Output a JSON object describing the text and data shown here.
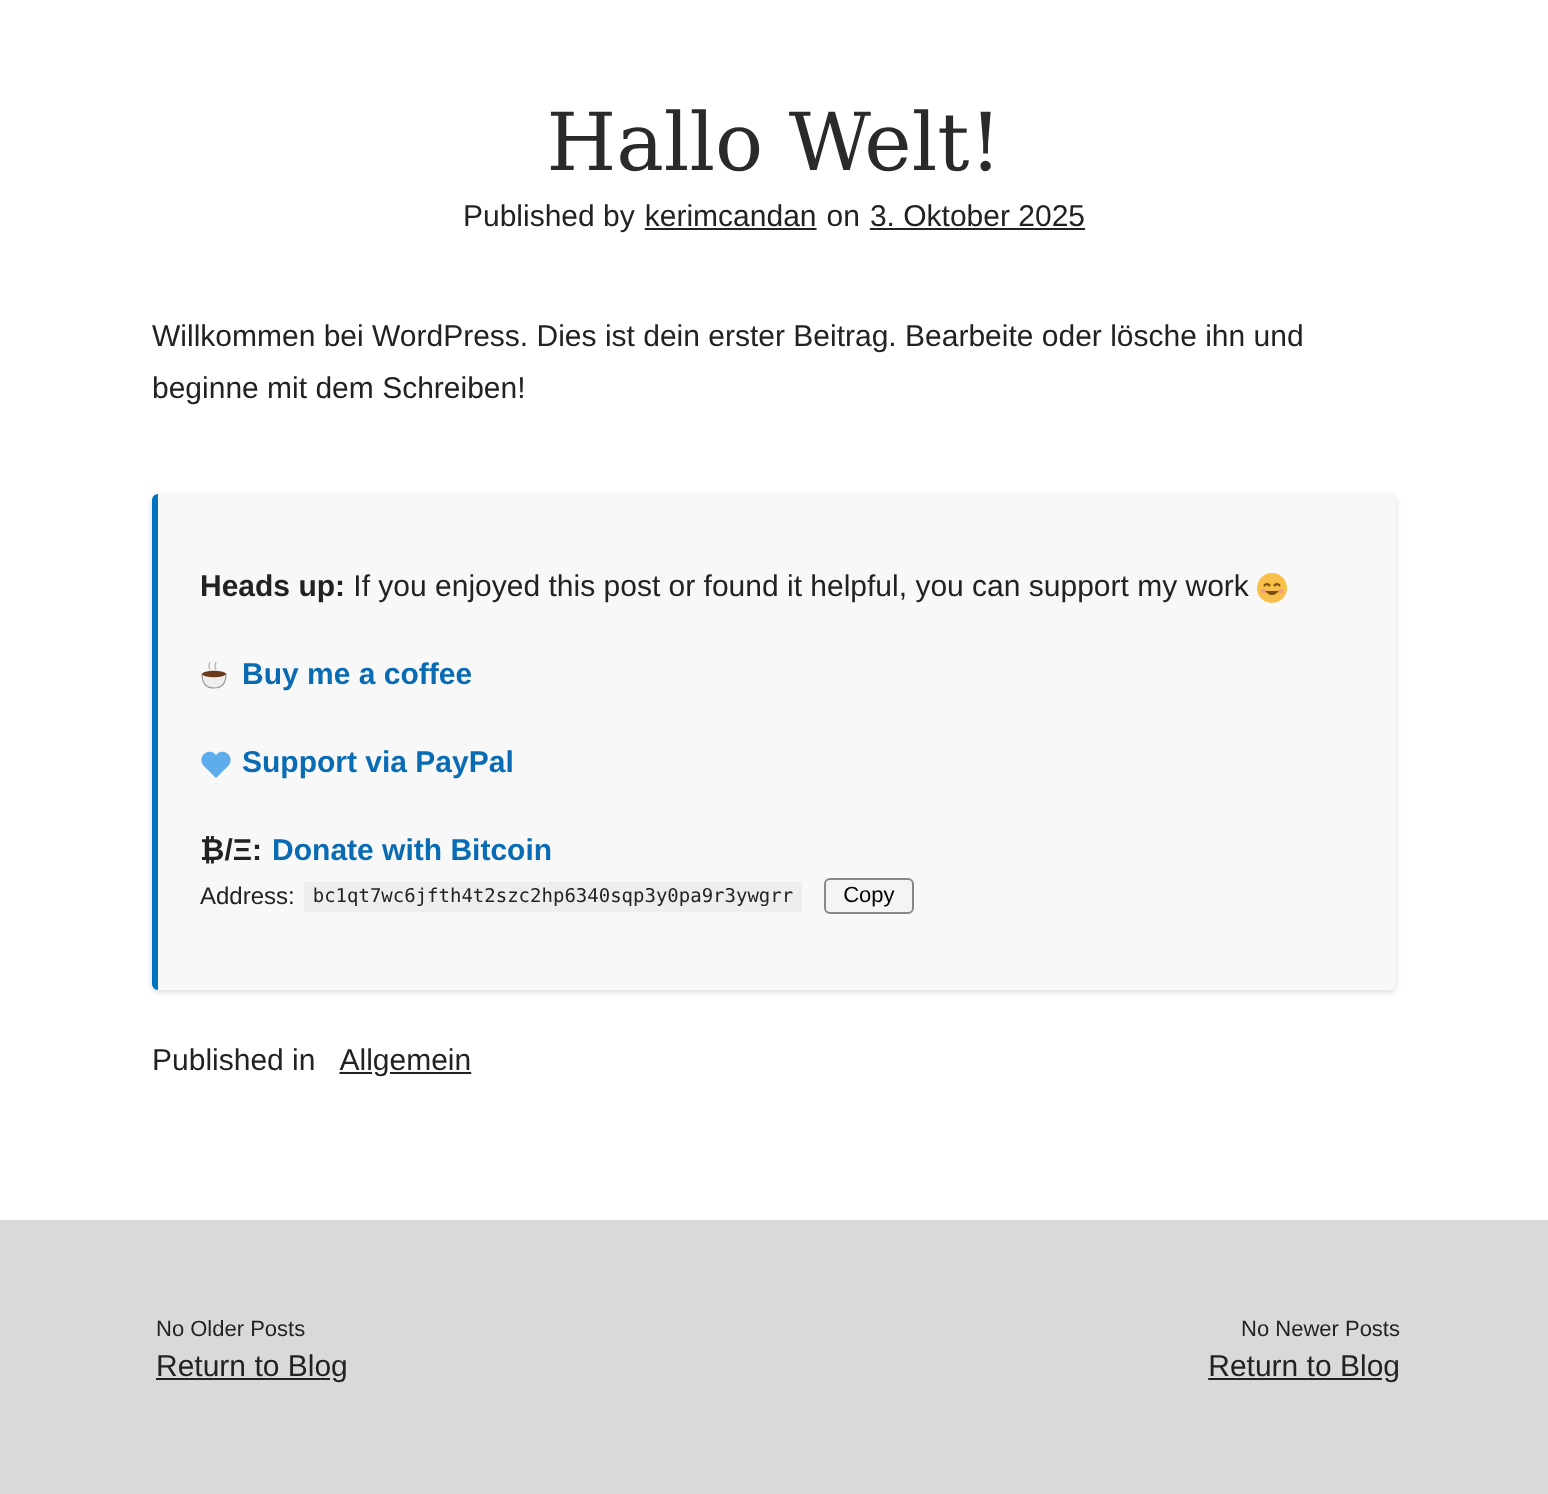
{
  "post": {
    "title": "Hallo Welt!",
    "byline": {
      "prefix": "Published by",
      "author": "kerimcandan",
      "on": "on",
      "date": "3. Oktober 2025"
    },
    "body": "Willkommen bei WordPress. Dies ist dein erster Beitrag. Bearbeite oder lösche ihn und beginne mit dem Schreiben!"
  },
  "support": {
    "intro": "**Heads up:** If you enjoyed this post or found it helpful, you can support my work",
    "links": [
      {
        "kind": "coffee",
        "label": "Buy me a coffee"
      },
      {
        "kind": "heart",
        "label": "Support via PayPal"
      },
      {
        "kind": "crypto",
        "prefix": "₿/Ξ:",
        "label": "Donate with Bitcoin"
      }
    ],
    "address": {
      "label": "Address:",
      "value": "bc1qt7wc6jfth4t2szc2hp6340sqp3y0pa9r3ywgrr",
      "button": "Copy"
    }
  },
  "category": {
    "label": "Published in",
    "value": "Allgemein"
  },
  "nav": [
    {
      "note": "No Older Posts",
      "link": "Return to Blog"
    },
    {
      "note": "No Newer Posts",
      "link": "Return to Blog"
    }
  ]
}
